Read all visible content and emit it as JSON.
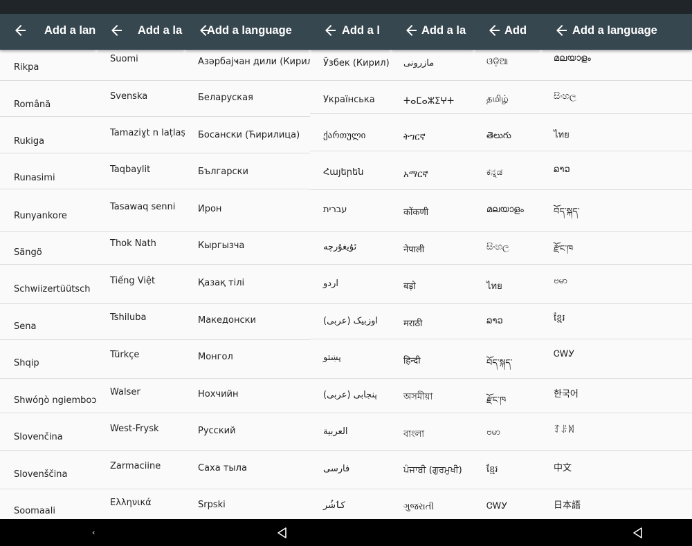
{
  "app_bar": {
    "title": "Add a language",
    "back_icon": "arrow-back-icon",
    "background": "#37474f"
  },
  "columns": [
    {
      "clip_title": "Add a lang",
      "items": [
        "Rikpa",
        "Română",
        "Rukiga",
        "Runasimi",
        "Runyankore",
        "Sängö",
        "Schwiizertüütsch",
        "Sena",
        "Shqip",
        "Shwóŋò ngiemboɔn",
        "Slovenčina",
        "Slovenščina",
        "Soomaali"
      ]
    },
    {
      "clip_title": "Add a la",
      "items": [
        "Suomi",
        "Svenska",
        "Tamaziɣt n laṭlaṣ",
        "Taqbaylit",
        "Tasawaq senni",
        "Thok Nath",
        "Tiếng Việt",
        "Tshiluba",
        "Türkçe",
        "Walser",
        "West-Frysk",
        "Zarmaciine",
        "Ελληνικά"
      ]
    },
    {
      "clip_title": "Add a language",
      "items": [
        "Азәрбајҹан дили (Кирил)",
        "Беларуская",
        "Босански (Ћирилица)",
        "Български",
        "Ирон",
        "Кыргызча",
        "Қазақ тілі",
        "Македонски",
        "Монгол",
        "Нохчийн",
        "Русский",
        "Саха тыла",
        "Srpski"
      ]
    },
    {
      "clip_title": "Add a l",
      "items": [
        "Ўзбек (Кирил)",
        "Українська",
        "ქართული",
        "Հայերեն",
        "עברית",
        "ئۇيغۇرچە",
        "اردو",
        "اوزبیک (عربی)",
        "پښتو",
        "پنجابی (عربی)",
        "العربية",
        "فارسی",
        "کٲشُر"
      ]
    },
    {
      "clip_title": "Add a la",
      "items": [
        "مازرونی",
        "ⵜⴰⵎⴰⵣⵉⵖⵜ",
        "ትግርኛ",
        "አማርኛ",
        "कोंकणी",
        "नेपाली",
        "बड़ो",
        "मराठी",
        "हिन्दी",
        "অসমীয়া",
        "বাংলা",
        "ਪੰਜਾਬੀ (ਗੁਰਮੁਖੀ)",
        "ગુજરાતી"
      ]
    },
    {
      "clip_title": "Add",
      "items": [
        "ଓଡ଼ିଆ",
        "தமிழ்",
        "తెలుగు",
        "ಕನ್ನಡ",
        "മലയാളം",
        "සිංහල",
        "ไทย",
        "ລາວ",
        "བོད་སྐད་",
        "རྫོང་ཁ",
        "ဗမာ",
        "ខ្មែរ",
        "ᏣᎳᎩ"
      ]
    },
    {
      "clip_title": "Add a language",
      "items": [
        "മലയാളം",
        "සිංහල",
        "ไทย",
        "ລາວ",
        "བོད་སྐད་",
        "རྫོང་ཁ",
        "ဗမာ",
        "ខ្មែរ",
        "ᏣᎳᎩ",
        "한국어",
        "ꆈꌠꉙ",
        "中文",
        "日本語"
      ]
    }
  ],
  "nav_bar": {
    "left_icon": "nav-back-small-icon",
    "center_icon": "nav-back-icon",
    "right_icon": "nav-back-icon"
  }
}
